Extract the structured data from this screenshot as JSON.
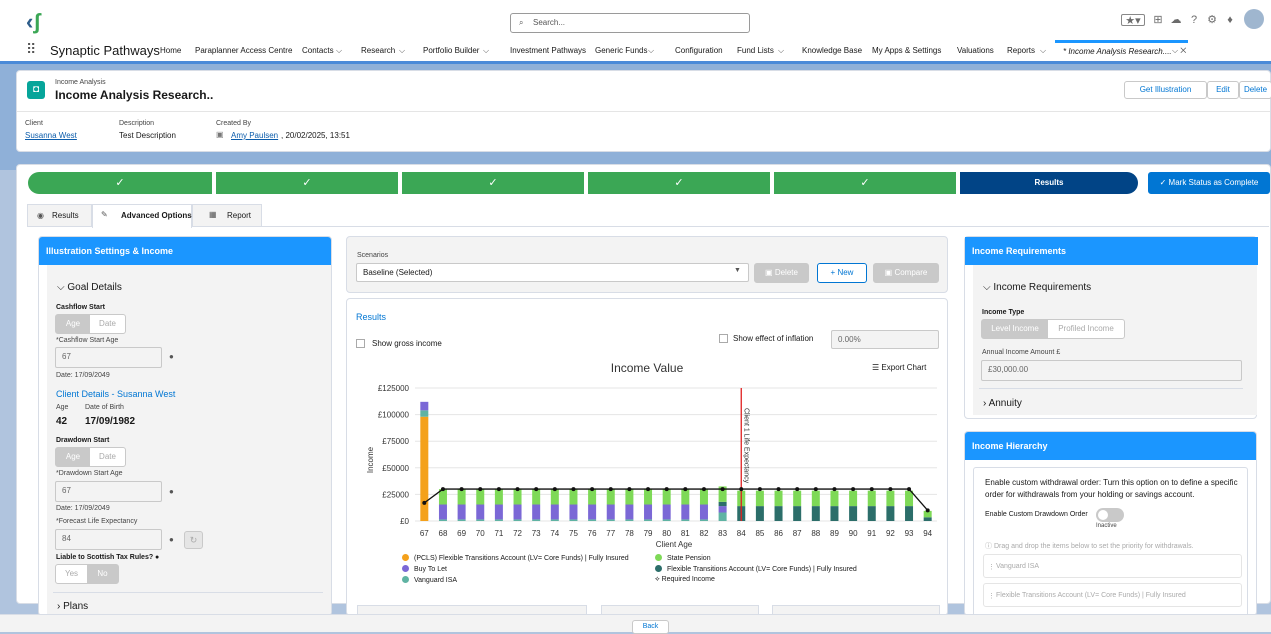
{
  "search": {
    "placeholder": "Search..."
  },
  "app_name": "Synaptic Pathways",
  "nav": {
    "items": [
      "Home",
      "Paraplanner Access Centre",
      "Contacts",
      "Research",
      "Portfolio Builder",
      "Investment Pathways",
      "Generic Funds",
      "Configuration",
      "Fund Lists",
      "Knowledge Base",
      "My Apps & Settings",
      "Valuations",
      "Reports"
    ],
    "active_tab": "* Income Analysis Research...."
  },
  "record": {
    "object": "Income Analysis",
    "title": "Income Analysis Research..",
    "actions": [
      "Get Illustration",
      "Edit",
      "Delete"
    ],
    "fields": {
      "client_label": "Client",
      "client": "Susanna West",
      "desc_label": "Description",
      "desc": "Test Description",
      "created_label": "Created By",
      "created_by": "Amy Paulsen",
      "created_on": ", 20/02/2025, 13:51"
    }
  },
  "path": {
    "steps": [
      "✓",
      "✓",
      "✓",
      "✓",
      "✓"
    ],
    "current": "Results",
    "mark_button": "✓  Mark Status as Complete"
  },
  "tabs": [
    "Results",
    "Advanced Options",
    "Report"
  ],
  "left": {
    "header": "Illustration Settings & Income",
    "goal_details": "Goal Details",
    "cashflow_start": "Cashflow Start",
    "age": "Age",
    "date": "Date",
    "cashflow_start_age_label": "*Cashflow Start Age",
    "cashflow_start_age": "67",
    "date1": "Date: 17/09/2049",
    "client_details": "Client Details - Susanna West",
    "age_label": "Age",
    "dob_label": "Date of Birth",
    "age_val": "42",
    "dob_val": "17/09/1982",
    "drawdown_start": "Drawdown Start",
    "drawdown_start_age_label": "*Drawdown Start Age",
    "drawdown_start_age": "67",
    "date2": "Date: 17/09/2049",
    "forecast_label": "*Forecast Life Expectancy",
    "forecast": "84",
    "scottish": "Liable to Scottish Tax Rules?",
    "yes": "Yes",
    "no": "No",
    "plans": "Plans"
  },
  "middle": {
    "scenarios_label": "Scenarios",
    "scenario": "Baseline (Selected)",
    "delete": "Delete",
    "new": "+ New",
    "compare": "Compare",
    "results": "Results",
    "show_gross": "Show gross income",
    "show_inflation": "Show effect of inflation",
    "inflation": "0.00%",
    "export": "Export Chart"
  },
  "right": {
    "header": "Income Requirements",
    "section": "Income Requirements",
    "income_type": "Income Type",
    "level": "Level Income",
    "profiled": "Profiled Income",
    "annual_label": "Annual Income Amount £",
    "annual": "£30,000.00",
    "annuity": "Annuity",
    "hier_header": "Income Hierarchy",
    "hier_text": "Enable custom withdrawal order: Turn this option on to define a specific order for withdrawals from your holding or savings account.",
    "enable_label": "Enable Custom Drawdown Order",
    "inactive": "Inactive",
    "drag_text": "Drag and drop the items below to set the priority for withdrawals.",
    "items": [
      "Vanguard ISA",
      "Flexible Transitions Account (LV= Core Funds) | Fully Insured"
    ]
  },
  "back": "Back",
  "chart_data": {
    "type": "bar",
    "title": "Income Value",
    "xlabel": "Client Age",
    "ylabel": "Income",
    "ylim": [
      0,
      125000
    ],
    "yticks": [
      "£0",
      "£25000",
      "£50000",
      "£75000",
      "£100000",
      "£125000"
    ],
    "categories": [
      "67",
      "68",
      "69",
      "70",
      "71",
      "72",
      "73",
      "74",
      "75",
      "76",
      "77",
      "78",
      "79",
      "80",
      "81",
      "82",
      "83",
      "84",
      "85",
      "86",
      "87",
      "88",
      "89",
      "90",
      "91",
      "92",
      "93",
      "94"
    ],
    "series": [
      {
        "name": "(PCLS) Flexible Transitions Account (LV= Core Funds) | Fully Insured",
        "color": "#f4a11b",
        "values": [
          98000,
          0,
          0,
          0,
          0,
          0,
          0,
          0,
          0,
          0,
          0,
          0,
          0,
          0,
          0,
          0,
          0,
          0,
          0,
          0,
          0,
          0,
          0,
          0,
          0,
          0,
          0,
          0
        ]
      },
      {
        "name": "Vanguard ISA",
        "color": "#5fb3a3",
        "values": [
          6000,
          1500,
          1500,
          1500,
          1500,
          1500,
          1500,
          1500,
          1500,
          1500,
          1500,
          1500,
          1500,
          1500,
          1500,
          1500,
          8000,
          0,
          0,
          0,
          0,
          0,
          0,
          0,
          0,
          0,
          0,
          0
        ]
      },
      {
        "name": "Buy To Let",
        "color": "#7b68d6",
        "values": [
          8000,
          14000,
          14000,
          14000,
          14000,
          14000,
          14000,
          14000,
          14000,
          14000,
          14000,
          14000,
          14000,
          14000,
          14000,
          14000,
          6000,
          0,
          0,
          0,
          0,
          0,
          0,
          0,
          0,
          0,
          0,
          0
        ]
      },
      {
        "name": "Flexible Transitions Account (LV= Core Funds) | Fully Insured",
        "color": "#2c6e6a",
        "values": [
          0,
          0,
          0,
          0,
          0,
          0,
          0,
          0,
          0,
          0,
          0,
          0,
          0,
          0,
          0,
          0,
          4000,
          14000,
          14000,
          14000,
          14000,
          14000,
          14000,
          14000,
          14000,
          14000,
          14000,
          3500
        ]
      },
      {
        "name": "State Pension",
        "color": "#7ed957",
        "values": [
          0,
          14500,
          14500,
          14500,
          14500,
          14500,
          14500,
          14500,
          14500,
          14500,
          14500,
          14500,
          14500,
          14500,
          14500,
          14500,
          14500,
          14500,
          14500,
          14500,
          14500,
          14500,
          14500,
          14500,
          14500,
          14500,
          14500,
          6000
        ]
      }
    ],
    "required_income": {
      "name": "Required Income",
      "values": [
        17000,
        30000,
        30000,
        30000,
        30000,
        30000,
        30000,
        30000,
        30000,
        30000,
        30000,
        30000,
        30000,
        30000,
        30000,
        30000,
        30000,
        30000,
        30000,
        30000,
        30000,
        30000,
        30000,
        30000,
        30000,
        30000,
        30000,
        10000
      ]
    },
    "annotation": {
      "label": "Client 1 Life Expectancy",
      "x": "84"
    },
    "legend_placement": "bottom"
  }
}
